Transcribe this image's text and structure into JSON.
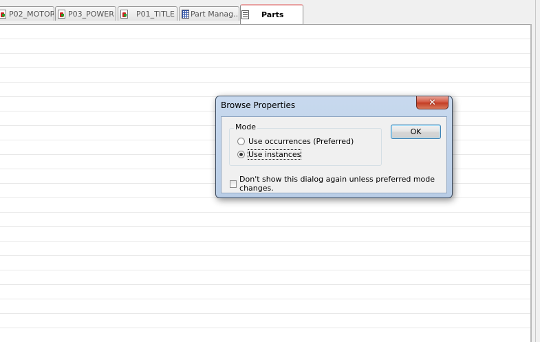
{
  "tabs": [
    {
      "label": "P02_MOTOR",
      "icon": "pdf-icon"
    },
    {
      "label": "P03_POWER",
      "icon": "pdf-icon"
    },
    {
      "label": "P01_TITLE",
      "icon": "pdf-icon"
    },
    {
      "label": "Part Manag...",
      "icon": "grid-icon"
    },
    {
      "label": "Parts",
      "icon": "parts-icon",
      "active": true
    }
  ],
  "dialog": {
    "title": "Browse Properties",
    "close_glyph": "✕",
    "mode": {
      "legend": "Mode",
      "options": [
        {
          "label": "Use occurrences (Preferred)",
          "selected": false
        },
        {
          "label": "Use instances",
          "selected": true
        }
      ]
    },
    "ok_label": "OK",
    "checkbox_label": "Don't show this dialog again unless preferred mode changes.",
    "checkbox_checked": false
  },
  "colors": {
    "title_bar": "#b9cde6",
    "close_button": "#c23a22",
    "active_tab_accent": "#e8a0a0",
    "row_line": "#e8e8e8"
  }
}
